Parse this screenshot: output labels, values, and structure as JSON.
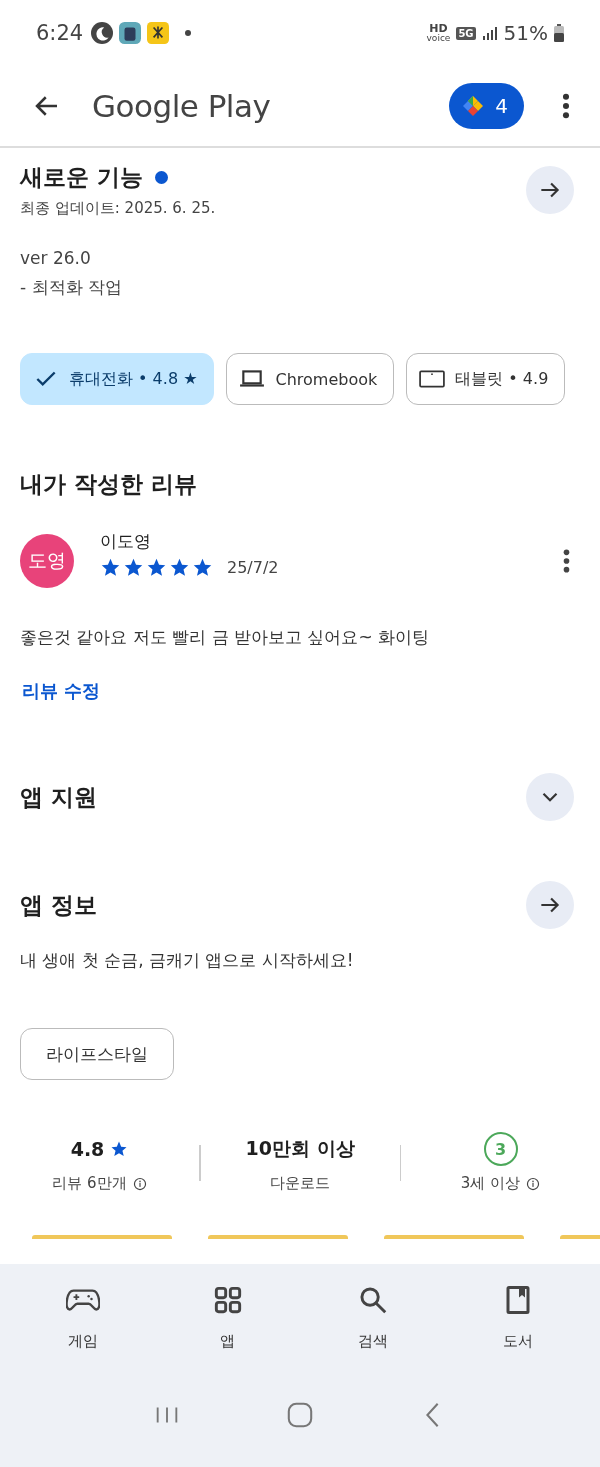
{
  "status_bar": {
    "time": "6:24",
    "hd": "HD",
    "voice": "voice",
    "network": "5G",
    "battery": "51%"
  },
  "app_bar": {
    "title": "Google Play",
    "points": "4"
  },
  "whats_new": {
    "title": "새로운 기능",
    "unread": true,
    "updated": "최종 업데이트: 2025. 6. 25.",
    "lines": [
      "ver 26.0",
      "- 최적화 작업"
    ]
  },
  "devices": [
    {
      "label": "휴대전화 • 4.8 ★",
      "selected": true
    },
    {
      "kind": "laptop",
      "label": "Chromebook",
      "selected": false
    },
    {
      "kind": "tablet",
      "label": "태블릿 • 4.9",
      "selected": false
    }
  ],
  "my_review": {
    "title": "내가 작성한 리뷰",
    "initials": "도영",
    "name": "이도영",
    "stars": 5,
    "date": "25/7/2",
    "text": "좋은것 같아요 저도 빨리 금 받아보고 싶어요~ 화이팅",
    "edit": "리뷰 수정"
  },
  "app_support": {
    "title": "앱 지원",
    "expanded": false
  },
  "about": {
    "title": "앱 정보",
    "description": "내 생애 첫 순금, 금캐기 앱으로 시작하세요!",
    "category": "라이프스타일"
  },
  "stats": [
    {
      "kind": "rating",
      "value": "4.8",
      "label": "리뷰 6만개"
    },
    {
      "kind": "downloads",
      "value": "10만회 이상",
      "label": "다운로드"
    },
    {
      "kind": "age",
      "value": "3",
      "label": "3세 이상"
    }
  ],
  "bottom_nav": [
    {
      "kind": "games",
      "label": "게임"
    },
    {
      "kind": "apps",
      "label": "앱"
    },
    {
      "kind": "search",
      "label": "검색"
    },
    {
      "kind": "books",
      "label": "도서"
    }
  ]
}
